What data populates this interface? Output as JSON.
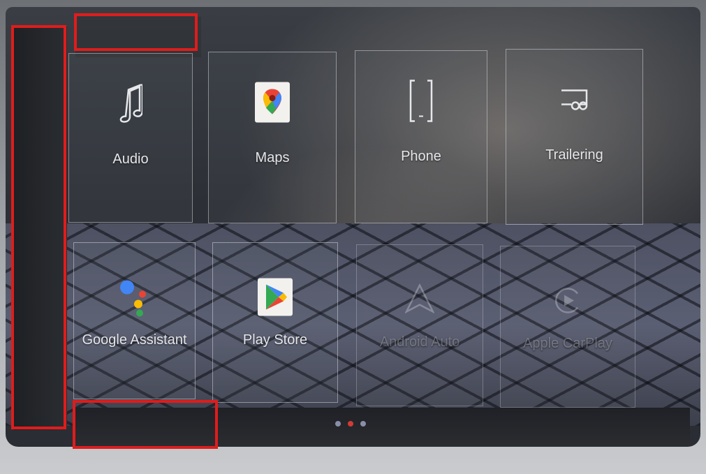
{
  "apps_row1": [
    {
      "label": "Audio",
      "icon": "music-note-icon"
    },
    {
      "label": "Maps",
      "icon": "google-maps-icon"
    },
    {
      "label": "Phone",
      "icon": "phone-icon"
    },
    {
      "label": "Trailering",
      "icon": "trailer-icon"
    }
  ],
  "apps_row2": [
    {
      "label": "Google Assistant",
      "icon": "google-assistant-icon"
    },
    {
      "label": "Play Store",
      "icon": "play-store-icon"
    },
    {
      "label": "Android Auto",
      "icon": "android-auto-icon",
      "state": "disabled"
    },
    {
      "label": "Apple CarPlay",
      "icon": "apple-carplay-icon",
      "state": "disabled"
    }
  ],
  "pagination": {
    "pages": 3,
    "current": 2
  },
  "colors": {
    "highlight_box": "#e01c1c",
    "active_dot": "#d23b35",
    "inactive_dot": "#8a8fa8"
  }
}
